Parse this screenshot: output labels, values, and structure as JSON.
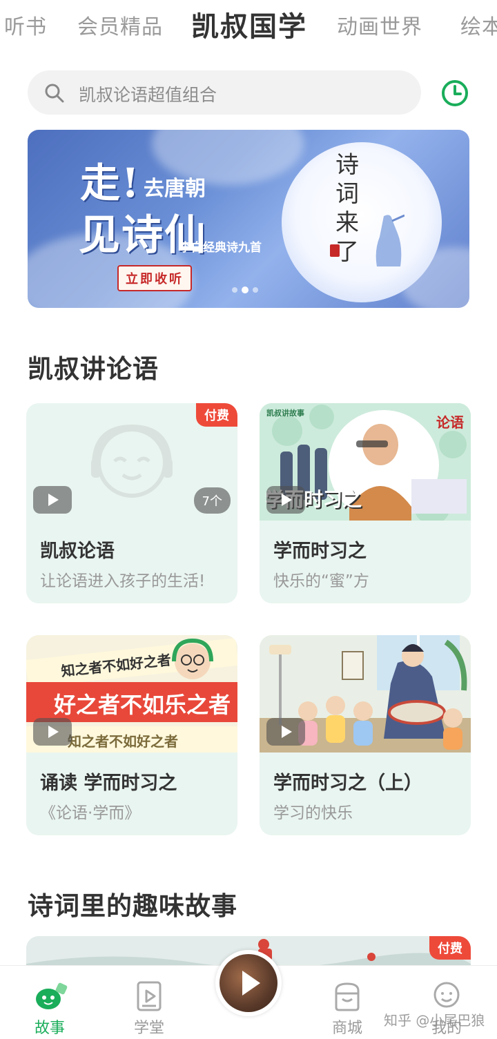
{
  "top_tabs": {
    "items": [
      "听书",
      "会员精品",
      "凯叔国学",
      "动画世界",
      "绘本"
    ],
    "active": "凯叔国学"
  },
  "search": {
    "placeholder": "凯叔论语超值组合",
    "icon": "search-icon"
  },
  "history_icon": "clock-icon",
  "banner": {
    "title_line1": "走!",
    "subtitle_line1": "去唐朝",
    "title_line2": "见诗仙",
    "caption": "李白经典诗九首",
    "button_label": "立即收听",
    "vertical_text": "诗词来了",
    "active_dot_index": 1,
    "dot_count": 3
  },
  "sections": [
    {
      "title": "凯叔讲论语",
      "cards": [
        {
          "title": "凯叔论语",
          "subtitle": "让论语进入孩子的生活!",
          "badge": "付费",
          "count": "7个"
        },
        {
          "title": "学而时习之",
          "subtitle": "快乐的“蜜”方",
          "thumb_brand": "凯叔讲故事",
          "thumb_logo": "论语",
          "thumb_caption": "学而时习之"
        },
        {
          "title": "诵读 学而时习之",
          "subtitle": "《论语·学而》",
          "thumb_caption1": "知之者不如好之者",
          "thumb_caption2": "好之者不如乐之者",
          "thumb_caption3": "知之者不如好之者"
        },
        {
          "title": "学而时习之（上）",
          "subtitle": "学习的快乐"
        }
      ]
    },
    {
      "title": "诗词里的趣味故事",
      "badge": "付费"
    }
  ],
  "bottom_nav": {
    "items": [
      {
        "label": "故事",
        "icon": "story-icon",
        "active": true
      },
      {
        "label": "学堂",
        "icon": "classroom-icon",
        "active": false
      },
      {
        "label": "商城",
        "icon": "shop-icon",
        "active": false
      },
      {
        "label": "我的",
        "icon": "profile-icon",
        "active": false
      }
    ]
  },
  "watermark": "知乎 @小尾巴狼",
  "colors": {
    "accent_green": "#1aad5a",
    "paid_red": "#ee4a3a",
    "card_bg": "#e9f5f0"
  }
}
